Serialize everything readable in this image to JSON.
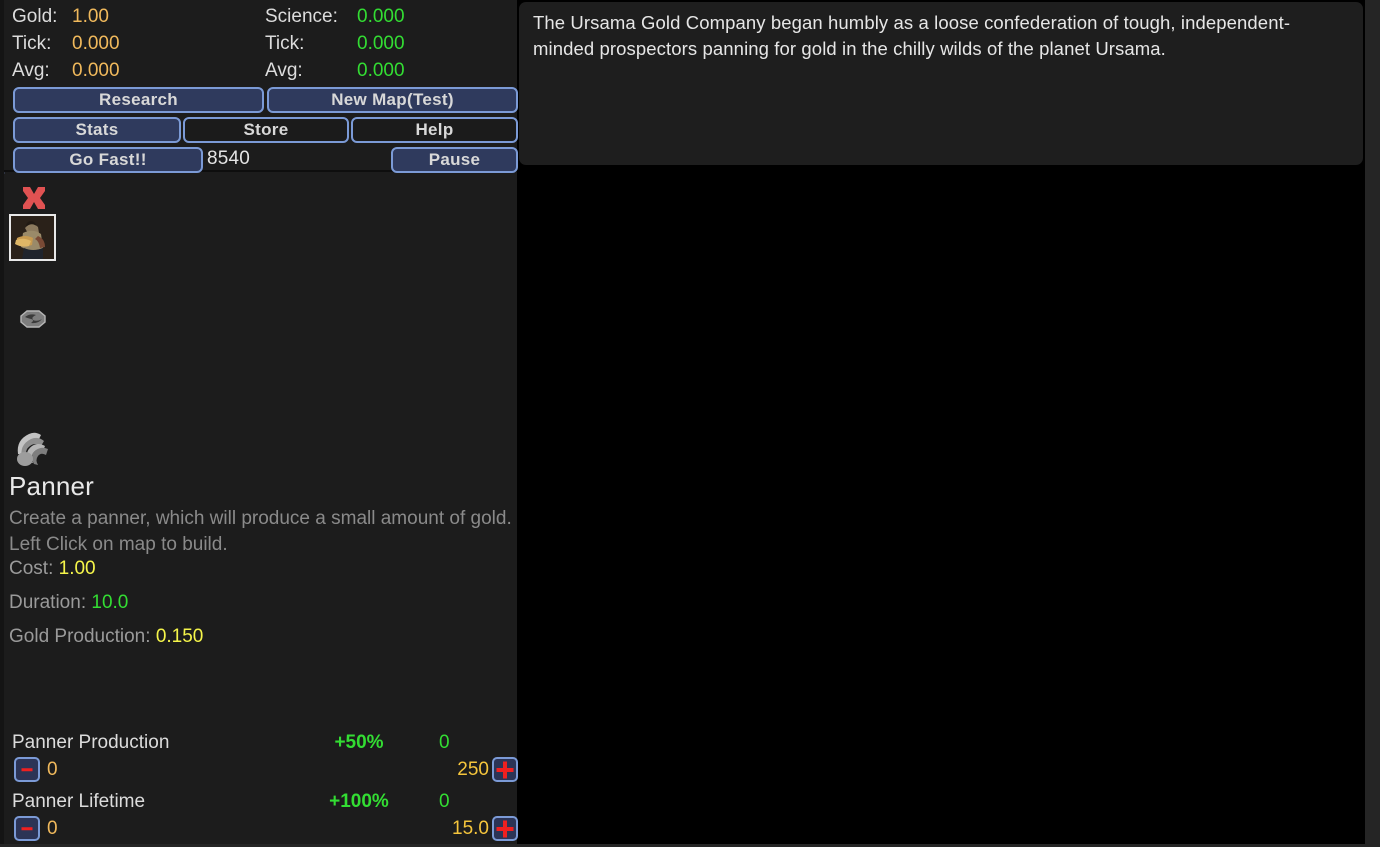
{
  "story": {
    "text": "The Ursama Gold Company began humbly as a loose confederation of tough, independent-minded prospectors panning for gold in the chilly wilds of the planet Ursama."
  },
  "hud": {
    "resources": [
      {
        "name": "gold",
        "rows": [
          {
            "label": "Gold:",
            "value": "1.00"
          },
          {
            "label": "Tick:",
            "value": "0.000"
          },
          {
            "label": "Avg:",
            "value": "0.000"
          }
        ]
      },
      {
        "name": "science",
        "rows": [
          {
            "label": "Science:",
            "value": "0.000"
          },
          {
            "label": "Tick:",
            "value": "0.000"
          },
          {
            "label": "Avg:",
            "value": "0.000"
          }
        ]
      }
    ],
    "buttons": {
      "research": "Research",
      "new_map": "New Map(Test)",
      "stats": "Stats",
      "store": "Store",
      "help": "Help",
      "go_fast": "Go Fast!!",
      "pause": "Pause"
    },
    "tick_counter": "8540"
  },
  "colors": {
    "gold": "#f0b95c",
    "science": "#33dd33",
    "yellow": "#f5f54a",
    "button_border": "#7b9ad6",
    "button_fill": "#2f3a5d",
    "red": "#f02020"
  },
  "build_panel": {
    "icons": [
      {
        "name": "cancel-x-icon",
        "label": "Cancel"
      },
      {
        "name": "panner-unit-icon",
        "label": "Panner",
        "selected": true
      },
      {
        "name": "gold-pan-icon",
        "label": "Pan"
      },
      {
        "name": "claw-icon",
        "label": "Claw"
      }
    ],
    "detail": {
      "title": "Panner",
      "description": "Create a panner, which will produce a small amount of gold. Left Click on map to build.",
      "stats": [
        {
          "label": "Cost: ",
          "value": "1.00",
          "color": "yellow"
        },
        {
          "label": "Duration: ",
          "value": "10.0",
          "color": "green"
        },
        {
          "label": "Gold Production: ",
          "value": "0.150",
          "color": "yellow"
        }
      ]
    },
    "upgrades": [
      {
        "name": "Panner Production",
        "bonus": "+50%",
        "owned": "0",
        "level": "0",
        "cost": "250",
        "minus_label": "-",
        "plus_label": "+"
      },
      {
        "name": "Panner Lifetime",
        "bonus": "+100%",
        "owned": "0",
        "level": "0",
        "cost": "15.0",
        "minus_label": "-",
        "plus_label": "+"
      }
    ]
  }
}
